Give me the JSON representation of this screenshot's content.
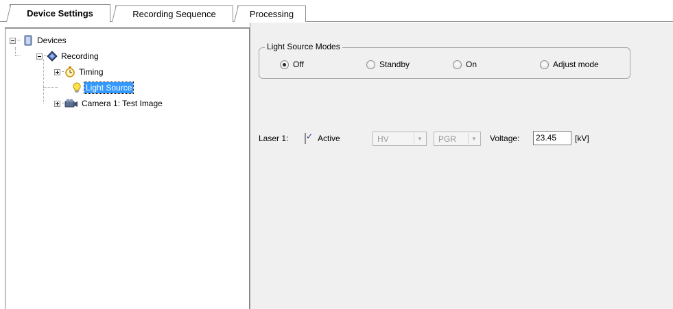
{
  "tabs": [
    {
      "label": "Device Settings",
      "active": true
    },
    {
      "label": "Recording Sequence",
      "active": false
    },
    {
      "label": "Processing",
      "active": false
    }
  ],
  "tree": {
    "devices": "Devices",
    "recording": "Recording",
    "timing": "Timing",
    "light_source": "Light Source",
    "camera": "Camera 1: Test Image"
  },
  "light_source_modes": {
    "title": "Light Source Modes",
    "options": [
      "Off",
      "Standby",
      "On",
      "Adjust mode"
    ],
    "selected": "Off"
  },
  "laser": {
    "label": "Laser 1:",
    "active_label": "Active",
    "active_checked": true,
    "combo1": "HV",
    "combo2": "PGR",
    "voltage_label": "Voltage:",
    "voltage_value": "23.45",
    "unit": "[kV]"
  },
  "colors": {
    "selection": "#3399ff",
    "panel_bg": "#f0f0f0"
  }
}
